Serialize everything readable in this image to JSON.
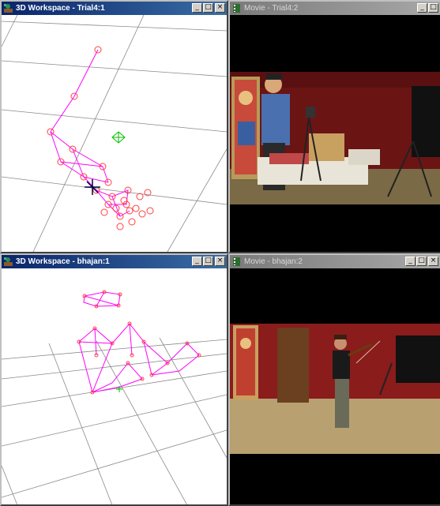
{
  "windows": {
    "ws1": {
      "title": "3D Workspace - Trial4:1",
      "icon": "workspace-3d-icon"
    },
    "mv1": {
      "title": "Movie - Trial4:2",
      "icon": "movie-icon"
    },
    "ws2": {
      "title": "3D Workspace - bhajan:1",
      "icon": "workspace-3d-icon"
    },
    "mv2": {
      "title": "Movie - bhajan:2",
      "icon": "movie-icon"
    }
  },
  "buttons": {
    "minimize": "_",
    "maximize": "□",
    "close": "×"
  },
  "colors": {
    "skeleton": "#ff00ff",
    "marker": "#ff4040",
    "grid": "#808080",
    "centroid": "#00c000",
    "cursor": "#000040",
    "title_active": "#0a246a",
    "title_inactive": "#7a7a7a",
    "wall_red": "#8a1c1c"
  }
}
